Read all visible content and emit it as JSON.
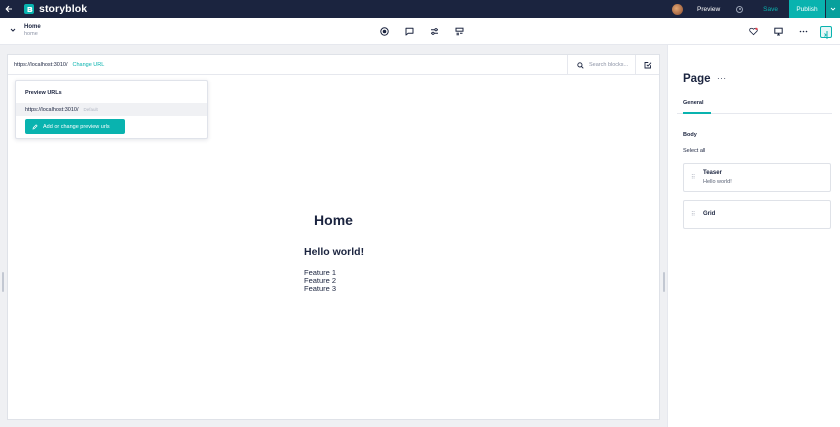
{
  "brand": {
    "name": "storyblok",
    "accent": "#09b3af",
    "dark": "#1b243f"
  },
  "topbar": {
    "preview_label": "Preview",
    "save_label": "Save",
    "publish_label": "Publish"
  },
  "story": {
    "name": "Home",
    "slug": "home"
  },
  "toolbar_icons": [
    "target-icon",
    "comment-icon",
    "sliders-icon",
    "layout-icon"
  ],
  "preview": {
    "url": "https://localhost:3010/",
    "change_url_label": "Change URL",
    "search_placeholder": "Search blocks..."
  },
  "dropdown": {
    "title": "Preview URLs",
    "url": "https://localhost:3010/",
    "default_label": "Default",
    "button_label": "Add or change preview urls"
  },
  "content": {
    "title": "Home",
    "heading": "Hello world!",
    "features": [
      "Feature 1",
      "Feature 2",
      "Feature 3"
    ]
  },
  "sidebar": {
    "title": "Page",
    "more_label": "···",
    "tab_general": "General",
    "body_label": "Body",
    "select_all": "Select all",
    "blocks": [
      {
        "name": "Teaser",
        "subtitle": "Hello world!"
      },
      {
        "name": "Grid",
        "subtitle": ""
      }
    ]
  }
}
